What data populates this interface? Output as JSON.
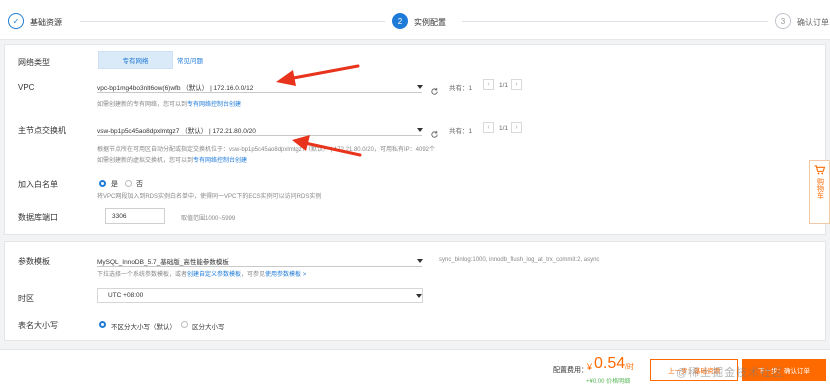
{
  "steps": [
    {
      "num": "✓",
      "label": "基础资源"
    },
    {
      "num": "2",
      "label": "实例配置"
    },
    {
      "num": "3",
      "label": "确认订单"
    }
  ],
  "network": {
    "label": "网络类型",
    "tab_active": "专有网络",
    "tab_other": "常见问题"
  },
  "vpc": {
    "label": "VPC",
    "value": "vpc-bp1mg4bo3nlt6ow(6)wfb （默认） | 172.16.0.0/12",
    "total": "共有：1",
    "page": "1/1",
    "hint_prefix": "如需创建新的专有网络，您可以到",
    "hint_link": "专有网络控制台创建"
  },
  "vswitch": {
    "label": "主节点交换机",
    "value": "vsw-bp1p5c45ao8dpxlmtgz7 （默认） | 172.21.80.0/20",
    "total": "共有：1",
    "page": "1/1",
    "hint1": "根据节点所在可用区自动分配或指定交换机位于：vsw-bp1p5c45ao8dpxlmtgz7（默认） | 172.21.80.0/20，可用私有IP：4092个",
    "hint2_prefix": "如需创建新的虚拟交换机，您可以到",
    "hint2_link": "专有网络控制台创建"
  },
  "whitelist": {
    "label": "加入白名单",
    "yes": "是",
    "no": "否",
    "hint": "将VPC网段加入到RDS实例白名单中，使得同一VPC下的ECS实例可以访问RDS实例"
  },
  "port": {
    "label": "数据库端口",
    "value": "3306",
    "hint": "取值范围1000~5999"
  },
  "params": {
    "label": "参数模板",
    "value": "MySQL_InnoDB_5.7_基础版_高性能参数模板",
    "summary": "sync_binlog:1000, innodb_flush_log_at_trx_commit:2, async",
    "hint_prefix": "下拉选择一个系统参数模板，或者",
    "hint_link1": "创建自定义参数模板",
    "hint_mid": "，可参见",
    "hint_link2": "使用参数模板 >"
  },
  "timezone": {
    "label": "时区",
    "value": "UTC +08:00"
  },
  "case": {
    "label": "表名大小写",
    "opt1": "不区分大小写（默认）",
    "opt2": "区分大小写"
  },
  "footer": {
    "fee_label": "配置费用：",
    "currency": "¥",
    "price": "0.54",
    "unit": "/时",
    "sub": "+¥0.00 价格明细",
    "prev": "上一步：基础资源",
    "next": "下一步：确认订单"
  },
  "cart": {
    "label": "购物车"
  },
  "watermark": "@稀土掘金技术社区",
  "colors": {
    "accent": "#ff6a00",
    "blue": "#1f7bd8",
    "arrow": "#e8341c"
  }
}
